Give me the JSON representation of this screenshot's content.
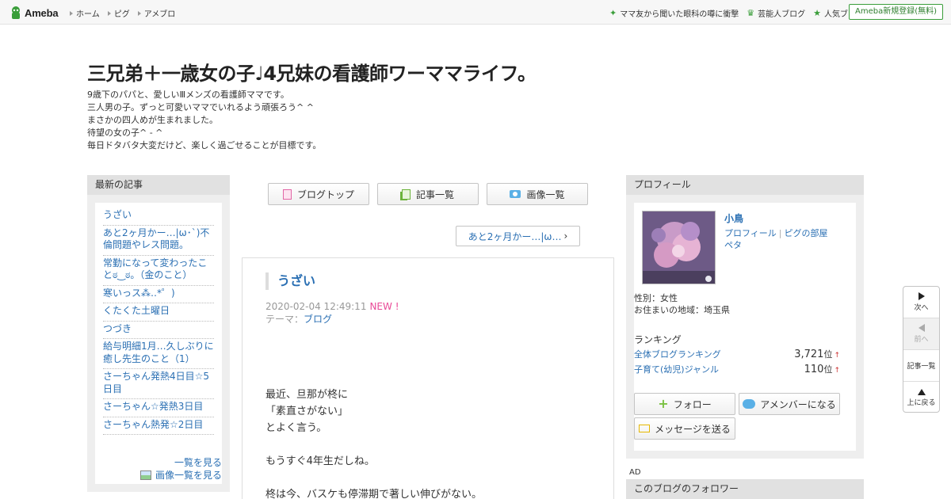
{
  "topbar": {
    "logo": "Ameba",
    "nav": [
      "ホーム",
      "ピグ",
      "アメブロ"
    ],
    "right_links": [
      {
        "icon": "sparkle-icon",
        "label": "ママ友から聞いた眼科の噂に衝撃"
      },
      {
        "icon": "crown-icon",
        "label": "芸能人ブログ"
      },
      {
        "icon": "star-icon",
        "label": "人気ブログ"
      }
    ],
    "register": "Ameba新規登録(無料)"
  },
  "header": {
    "title": "三兄弟＋一歳女の子♩4兄妹の看護師ワーママライフ。",
    "description": [
      "9歳下のパパと、愛しいⅢメンズの看護師ママです。",
      "三人男の子。ずっと可愛いママでいれるよう頑張ろう^ ^",
      "まさかの四人めが生まれました。",
      "待望の女の子^ - ^",
      "毎日ドタバタ大変だけど、楽しく過ごせることが目標です。"
    ]
  },
  "left": {
    "heading": "最新の記事",
    "articles": [
      "うざい",
      "あと2ヶ月かー…|ω･`)不倫問題やレス問題。",
      "常勤になって変わったことಠ‿ಠ。（金のこと）",
      "寒いっス⁂‥*゜)",
      "くたくた土曜日",
      "つづき",
      "給与明細1月…久しぶりに癒し先生のこと（1）",
      "さーちゃん発熱4日目☆5日目",
      "さーちゃん☆発熱3日目",
      "さーちゃん熱発☆2日目"
    ],
    "see_all": "一覧を見る",
    "see_images": "画像一覧を見る"
  },
  "main": {
    "buttons": {
      "blog_top": "ブログトップ",
      "articles": "記事一覧",
      "images": "画像一覧"
    },
    "prev_link": "あと2ヶ月かー…|ω…",
    "entry": {
      "title": "うざい",
      "date": "2020-02-04 12:49:11",
      "new": "NEW !",
      "theme_label": "テーマ：",
      "theme": "ブログ",
      "body": [
        "最近、旦那が柊に",
        "「素直さがない」",
        "とよく言う。",
        "",
        "もうすぐ4年生だしね。",
        "",
        "柊は今、バスケも停滞期で著しい伸びがない。"
      ]
    }
  },
  "right": {
    "heading": "プロフィール",
    "name": "小鳥",
    "links": [
      "プロフィール",
      "ピグの部屋",
      "ペタ"
    ],
    "gender": "性別：女性",
    "region": "お住まいの地域：埼玉県",
    "ranking_heading": "ランキング",
    "rankings": [
      {
        "label": "全体ブログランキング",
        "value": "3,721",
        "unit": "位",
        "arrow": "↑"
      },
      {
        "label": "子育て(幼児)ジャンル",
        "value": "110",
        "unit": "位",
        "arrow": "↑"
      }
    ],
    "follow": "フォロー",
    "amember": "アメンバーになる",
    "message": "メッセージを送る",
    "ad": "AD",
    "followers_heading": "このブログのフォロワー"
  },
  "sidenav": {
    "next": "次へ",
    "prev": "前へ",
    "list": "記事一覧",
    "top": "上に戻る"
  },
  "colors": {
    "link": "#2a6fb3",
    "new": "#e94a97",
    "green": "#3a9e3a"
  }
}
